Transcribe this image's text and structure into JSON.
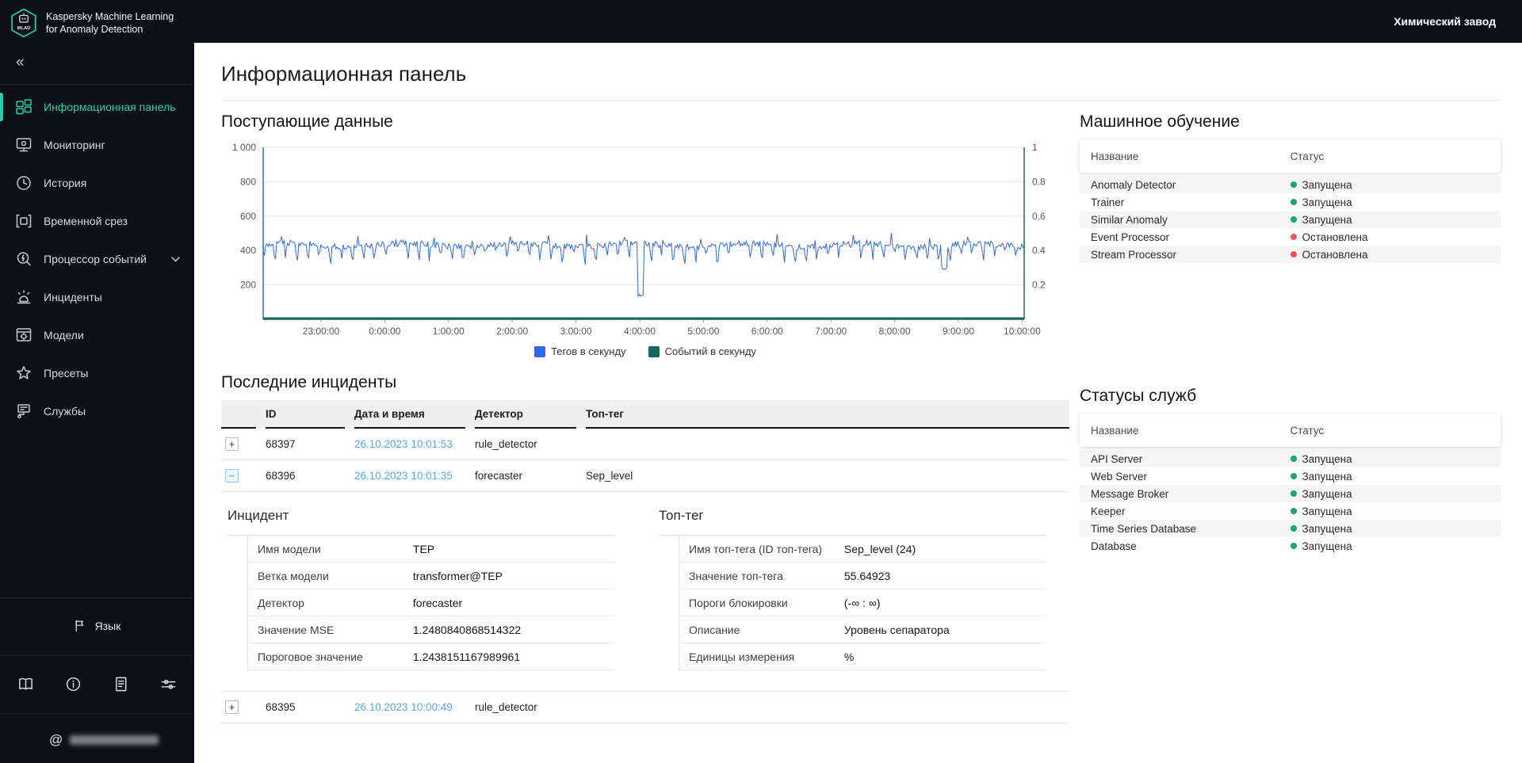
{
  "topbar": {
    "tenant": "Химический завод"
  },
  "sidebar": {
    "logo_text": "MLAD",
    "app_title_line1": "Kaspersky Machine Learning",
    "app_title_line2": "for Anomaly Detection",
    "collapse_glyph": "«",
    "items": [
      {
        "label": "Информационная панель",
        "active": true
      },
      {
        "label": "Мониторинг"
      },
      {
        "label": "История"
      },
      {
        "label": "Временной срез"
      },
      {
        "label": "Процессор событий",
        "has_chevron": true
      },
      {
        "label": "Инциденты"
      },
      {
        "label": "Модели"
      },
      {
        "label": "Пресеты"
      },
      {
        "label": "Службы"
      }
    ],
    "language_label": "Язык",
    "at_glyph": "@"
  },
  "page": {
    "title": "Информационная панель"
  },
  "incoming_data": {
    "title": "Поступающие данные"
  },
  "chart_data": {
    "type": "line",
    "title": "Поступающие данные",
    "x_ticks": [
      "23:00:00",
      "0:00:00",
      "1:00:00",
      "2:00:00",
      "3:00:00",
      "4:00:00",
      "5:00:00",
      "6:00:00",
      "7:00:00",
      "8:00:00",
      "9:00:00",
      "10:00:00"
    ],
    "left_axis": {
      "ticks": [
        "1 000",
        "800",
        "600",
        "400",
        "200"
      ],
      "range": [
        0,
        1000
      ],
      "color": "#2d68e6"
    },
    "right_axis": {
      "ticks": [
        "1",
        "0.8",
        "0.6",
        "0.4",
        "0.2"
      ],
      "range": [
        0,
        1
      ],
      "color": "#16695a"
    },
    "grid": true,
    "legend_position": "bottom",
    "series": [
      {
        "name": "Тегов в секунду",
        "axis": "left",
        "color": "#2d68e6",
        "baseline": 432,
        "typical_band": [
          330,
          505
        ],
        "anomalies": [
          {
            "time": "4:00:00",
            "value": 130,
            "x_fraction": 0.496
          },
          {
            "time": "8:45:00",
            "value": 290,
            "x_fraction": 0.895
          }
        ]
      },
      {
        "name": "Событий в секунду",
        "axis": "right",
        "color": "#16695a",
        "baseline": 0
      }
    ]
  },
  "ml_services": {
    "title": "Машинное обучение",
    "columns": [
      "Название",
      "Статус"
    ],
    "rows": [
      {
        "name": "Anomaly Detector",
        "status": "Запущена",
        "dot_color": "#1fa37e"
      },
      {
        "name": "Trainer",
        "status": "Запущена",
        "dot_color": "#1fa37e"
      },
      {
        "name": "Similar Anomaly",
        "status": "Запущена",
        "dot_color": "#1fa37e"
      },
      {
        "name": "Event Processor",
        "status": "Остановлена",
        "dot_color": "#f4515f"
      },
      {
        "name": "Stream Processor",
        "status": "Остановлена",
        "dot_color": "#f4515f"
      }
    ]
  },
  "service_statuses": {
    "title": "Статусы служб",
    "columns": [
      "Название",
      "Статус"
    ],
    "rows": [
      {
        "name": "API Server",
        "status": "Запущена",
        "dot_color": "#1fa37e"
      },
      {
        "name": "Web Server",
        "status": "Запущена",
        "dot_color": "#1fa37e"
      },
      {
        "name": "Message Broker",
        "status": "Запущена",
        "dot_color": "#1fa37e"
      },
      {
        "name": "Keeper",
        "status": "Запущена",
        "dot_color": "#1fa37e"
      },
      {
        "name": "Time Series Database",
        "status": "Запущена",
        "dot_color": "#1fa37e"
      },
      {
        "name": "Database",
        "status": "Запущена",
        "dot_color": "#1fa37e"
      }
    ]
  },
  "incidents": {
    "title": "Последние инциденты",
    "columns": [
      "ID",
      "Дата и время",
      "Детектор",
      "Топ-тег"
    ],
    "rows": [
      {
        "id": "68397",
        "datetime": "26.10.2023 10:01:53",
        "detector": "rule_detector",
        "top_tag": "",
        "toggle": "+",
        "expanded": false
      },
      {
        "id": "68396",
        "datetime": "26.10.2023 10:01:35",
        "detector": "forecaster",
        "top_tag": "Sep_level",
        "toggle": "−",
        "expanded": true
      },
      {
        "id": "68395",
        "datetime": "26.10.2023 10:00:49",
        "detector": "rule_detector",
        "top_tag": "",
        "toggle": "+",
        "expanded": false
      }
    ],
    "detail": {
      "incident_section": {
        "title": "Инцидент",
        "fields": [
          [
            "Имя модели",
            "TEP"
          ],
          [
            "Ветка модели",
            "transformer@TEP"
          ],
          [
            "Детектор",
            "forecaster"
          ],
          [
            "Значение MSE",
            "1.2480840868514322"
          ],
          [
            "Пороговое значение",
            "1.2438151167989961"
          ]
        ]
      },
      "toptag_section": {
        "title": "Топ-тег",
        "fields": [
          [
            "Имя топ-тега (ID топ-тега)",
            "Sep_level (24)"
          ],
          [
            "Значение топ-тега",
            "55.64923"
          ],
          [
            "Пороги блокировки",
            "(-∞ : ∞)"
          ],
          [
            "Описание",
            "Уровень сепаратора"
          ],
          [
            "Единицы измерения",
            "%"
          ]
        ]
      }
    }
  }
}
